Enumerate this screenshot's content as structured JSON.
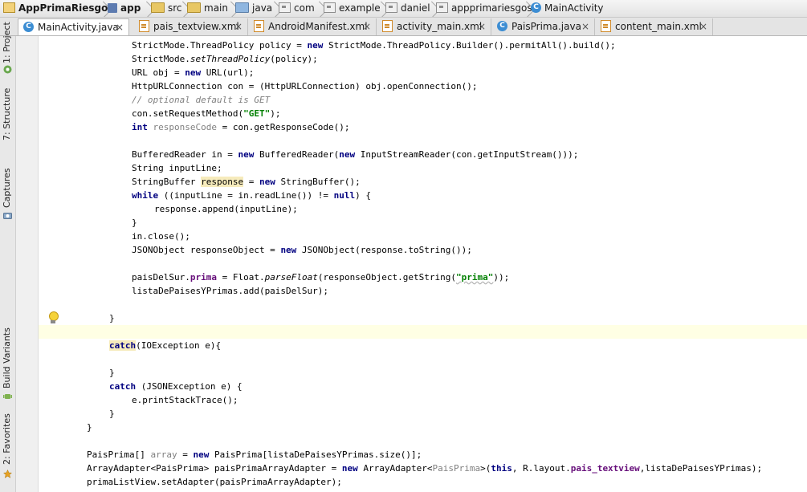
{
  "breadcrumb": {
    "items": [
      "AppPrimaRiesgos",
      "app",
      "src",
      "main",
      "java",
      "com",
      "example",
      "daniel",
      "appprimariesgos",
      "MainActivity"
    ]
  },
  "tabs": [
    {
      "label": "MainActivity.java",
      "close": "×"
    },
    {
      "label": "pais_textview.xml",
      "close": "×"
    },
    {
      "label": "AndroidManifest.xml",
      "close": "×"
    },
    {
      "label": "activity_main.xml",
      "close": "×"
    },
    {
      "label": "PaisPrima.java",
      "close": "×"
    },
    {
      "label": "content_main.xml",
      "close": "×"
    }
  ],
  "sidebar": {
    "tools": [
      "1: Project",
      "7: Structure",
      "Captures",
      "Build Variants",
      "2: Favorites"
    ]
  },
  "editor": {
    "code": {
      "l1_a": "StrictMode.ThreadPolicy policy = ",
      "l1_new": "new",
      "l1_b": " StrictMode.ThreadPolicy.Builder().permitAll().build();",
      "l2_a": "StrictMode.",
      "l2_it": "setThreadPolicy",
      "l2_b": "(policy);",
      "l3_a": "URL obj = ",
      "l3_new": "new",
      "l3_b": " URL(url);",
      "l4": "HttpURLConnection con = (HttpURLConnection) obj.openConnection();",
      "l5": "// optional default is GET",
      "l6_a": "con.setRequestMethod(",
      "l6_str": "\"GET\"",
      "l6_b": ");",
      "l7_int": "int",
      "l7_var": " responseCode",
      "l7_b": " = con.getResponseCode();",
      "l9_a": "BufferedReader in = ",
      "l9_new": "new",
      "l9_b": " BufferedReader(",
      "l9_new2": "new",
      "l9_c": " InputStreamReader(con.getInputStream()));",
      "l10": "String inputLine;",
      "l11_a": "StringBuffer ",
      "l11_hl": "response",
      "l11_b": " = ",
      "l11_new": "new",
      "l11_c": " StringBuffer();",
      "l12_while": "while",
      "l12_a": " ((inputLine = in.readLine()) != ",
      "l12_null": "null",
      "l12_b": ") {",
      "l13": "response.append(inputLine);",
      "l14": "}",
      "l15": "in.close();",
      "l16_a": "JSONObject responseObject = ",
      "l16_new": "new",
      "l16_b": " JSONObject(response.toString());",
      "l18_a": "paisDelSur.",
      "l18_fld": "prima",
      "l18_b": " = Float.",
      "l18_it": "parseFloat",
      "l18_c": "(responseObject.getString(",
      "l18_str": "\"prima\"",
      "l18_d": "));",
      "l19": "listaDePaisesYPrimas.add(paisDelSur);",
      "l21": "}",
      "l23_catch": "catch",
      "l23_b": "(IOException e){",
      "l25": "}",
      "l26_catch": "catch",
      "l26_b": " (JSONException e) {",
      "l27": "e.printStackTrace();",
      "l28": "}",
      "l29": "}",
      "l31_a": "PaisPrima[] ",
      "l31_var": "array",
      "l31_b": " = ",
      "l31_new": "new",
      "l31_c": " PaisPrima[listaDePaisesYPrimas.size()];",
      "l32_a": "ArrayAdapter<PaisPrima> paisPrimaArrayAdapter = ",
      "l32_new": "new",
      "l32_b": " ArrayAdapter<",
      "l32_gray": "PaisPrima",
      "l32_c": ">(",
      "l32_this": "this",
      "l32_d": ", R.layout.",
      "l32_fld": "pais_textview",
      "l32_e": ",listaDePaisesYPrimas);",
      "l33": "primaListView.setAdapter(paisPrimaArrayAdapter);"
    }
  },
  "colors": {
    "keyword": "#000080",
    "string": "#008000",
    "comment": "#808080",
    "field": "#660e7a",
    "current_line": "#ffffe4",
    "highlight": "#f6ebbc"
  }
}
